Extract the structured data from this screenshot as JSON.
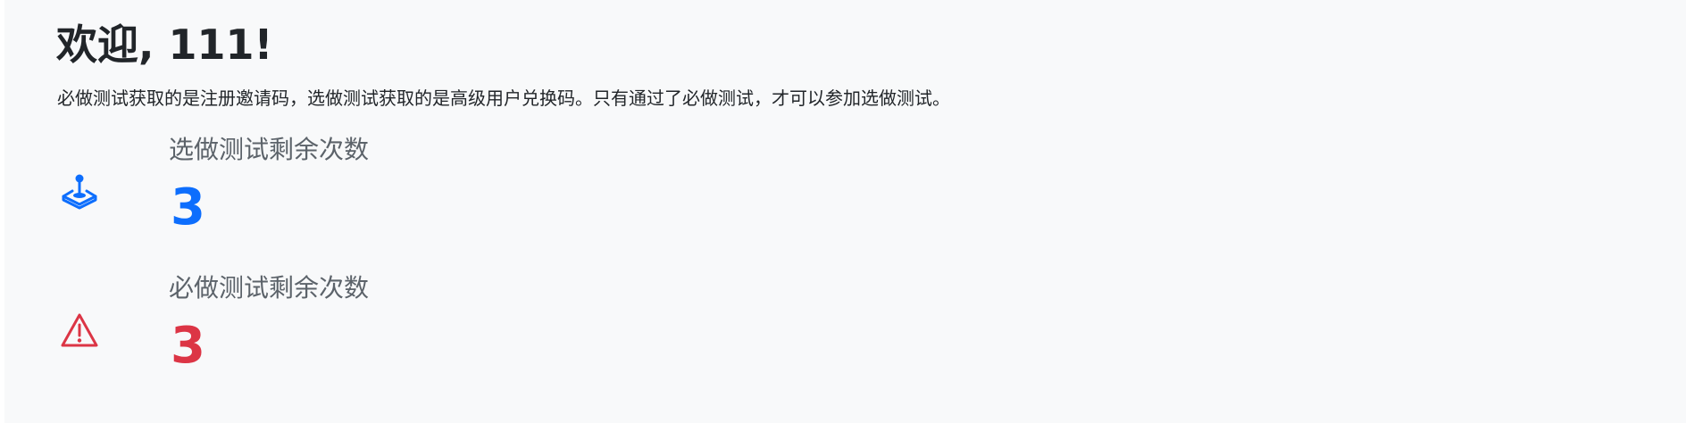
{
  "header": {
    "title": "欢迎, 111!",
    "description": "必做测试获取的是注册邀请码，选做测试获取的是高级用户兑换码。只有通过了必做测试，才可以参加选做测试。"
  },
  "stats": {
    "optional": {
      "label": "选做测试剩余次数",
      "value": "3",
      "icon": "joystick-icon",
      "color": "#0d6efd"
    },
    "required": {
      "label": "必做测试剩余次数",
      "value": "3",
      "icon": "warning-triangle-icon",
      "color": "#dc3545"
    }
  },
  "colors": {
    "background": "#f8f9fa",
    "text": "#212529",
    "muted": "#5c636a"
  }
}
